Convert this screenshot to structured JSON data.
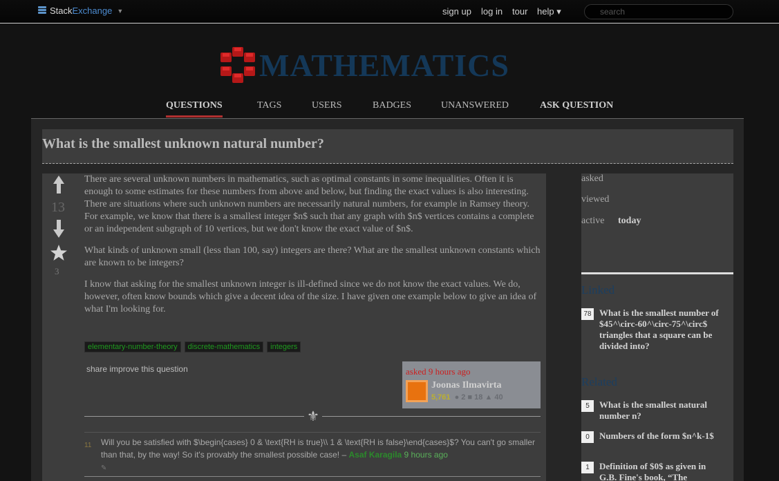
{
  "topbar": {
    "brand_a": "Stack",
    "brand_b": "Exchange",
    "nav": [
      "sign up",
      "log in",
      "tour",
      "help ▾"
    ],
    "search_placeholder": "search"
  },
  "site": {
    "title": "MATHEMATICS",
    "nav": [
      "QUESTIONS",
      "TAGS",
      "USERS",
      "BADGES",
      "UNANSWERED",
      "ASK QUESTION"
    ]
  },
  "question": {
    "title": "What is the smallest unknown natural number?",
    "votes": "13",
    "favorites": "3",
    "paragraphs": [
      "There are several unknown numbers in mathematics, such as optimal constants in some inequalities. Often it is enough to some estimates for these numbers from above and below, but finding the exact values is also interesting. There are situations where such unknown numbers are necessarily natural numbers, for example in Ramsey theory. For example, we know that there is a smallest integer $n$ such that any graph with $n$ vertices contains a complete or an independent subgraph of 10 vertices, but we don't know the exact value of $n$.",
      "What kinds of unknown small (less than 100, say) integers are there? What are the smallest unknown constants which are known to be integers?",
      "I know that asking for the smallest unknown integer is ill-defined since we do not know the exact values. We do, however, often know bounds which give a decent idea of the size. I have given one example below to give an idea of what I'm looking for."
    ],
    "tags": [
      "elementary-number-theory",
      "discrete-mathematics",
      "integers"
    ],
    "share_label": "share",
    "improve_label": "improve this question",
    "asked": "asked 9 hours ago",
    "owner_name": "Joonas Ilmavirta",
    "owner_rep": "5,761",
    "owner_badges": "● 2  ■ 18  ▲ 40"
  },
  "comment": {
    "score": "11",
    "text": "Will you be satisfied with $\\begin{cases} 0 & \\text{RH is true}\\\\ 1 & \\text{RH is false}\\end{cases}$? You can't go smaller than that, by the way! So it's provably the smallest possible case! –",
    "user": "Asaf Karagila",
    "time": "9 hours ago",
    "edit": "✎"
  },
  "sidebar": {
    "stats": {
      "asked": "asked",
      "viewed": "viewed",
      "active": "active",
      "active_value": "today"
    },
    "linked_heading": "Linked",
    "linked": [
      {
        "count": "78",
        "title": "What is the smallest number of $45^\\circ-60^\\circ-75^\\circ$ triangles that a square can be divided into?"
      }
    ],
    "related_heading": "Related",
    "related": [
      {
        "count": "5",
        "title": "What is the smallest natural number n?"
      },
      {
        "count": "0",
        "title": "Numbers of the form $n^k-1$"
      },
      {
        "count": "1",
        "title": "Definition of $0$ as given in G.B. Fine's book, “The"
      }
    ]
  },
  "colors": {
    "accent_red": "#cc1f1f",
    "tag_green": "#1f9a1f",
    "title_blue": "#143858"
  }
}
